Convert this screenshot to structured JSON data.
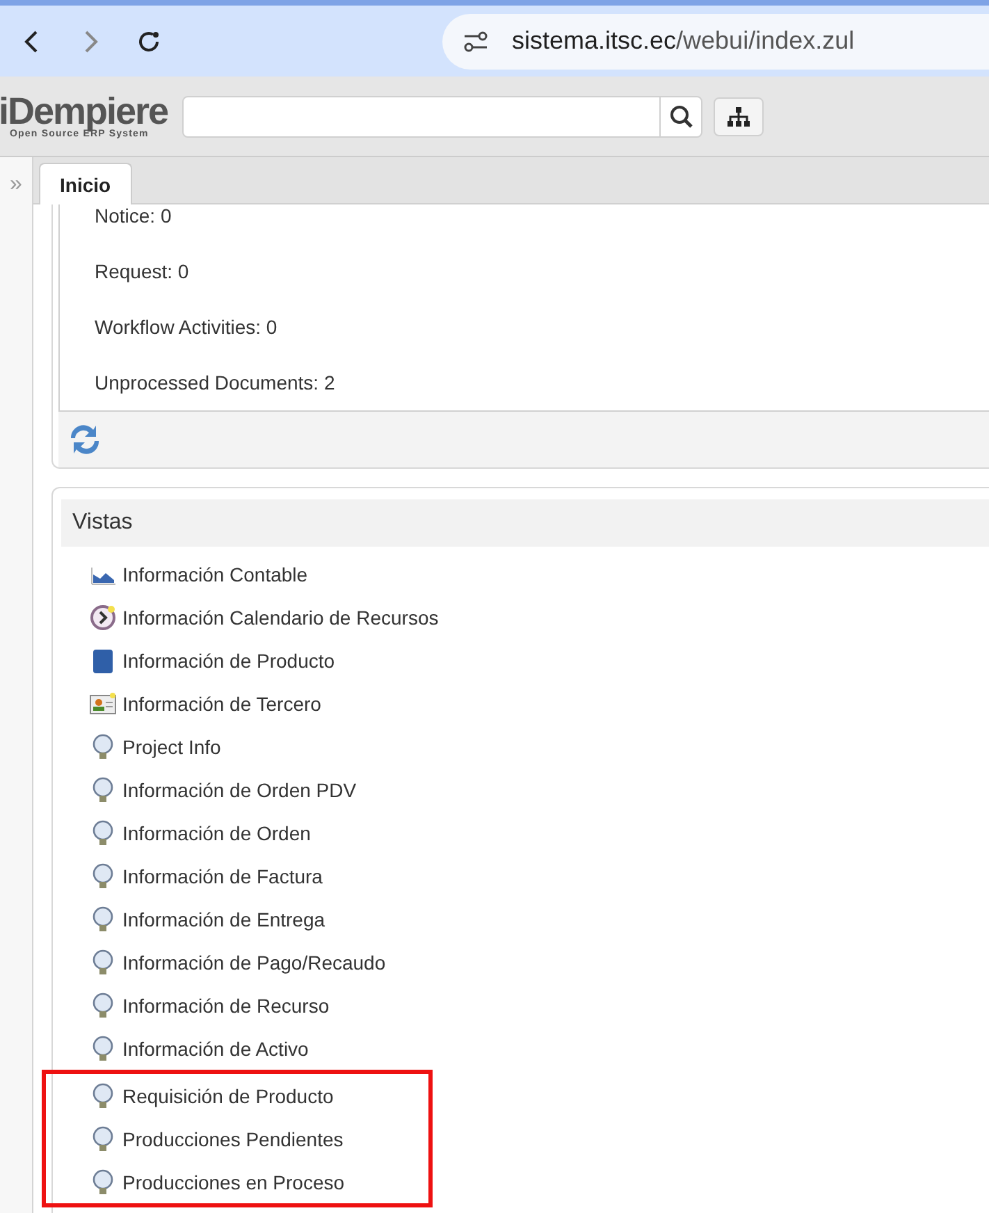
{
  "browser": {
    "url_host": "sistema.itsc.ec",
    "url_path": "/webui/index.zul"
  },
  "header": {
    "logo_title": "iDempiere",
    "logo_subtitle": "Open Source ERP System"
  },
  "sidebar": {
    "toggle": "»"
  },
  "tabs": [
    {
      "label": "Inicio",
      "selected": true
    }
  ],
  "activities": [
    "Notice: 0",
    "Request: 0",
    "Workflow Activities: 0",
    "Unprocessed Documents: 2"
  ],
  "views": {
    "title": "Vistas",
    "items": [
      {
        "label": "Información Contable",
        "kind": "chart",
        "highlighted": false
      },
      {
        "label": "Información Calendario de Recursos",
        "kind": "clock",
        "highlighted": false
      },
      {
        "label": "Información de Producto",
        "kind": "product",
        "highlighted": false
      },
      {
        "label": "Información de Tercero",
        "kind": "card",
        "highlighted": false
      },
      {
        "label": "Project Info",
        "kind": "bulb",
        "highlighted": false
      },
      {
        "label": "Información de Orden PDV",
        "kind": "bulb",
        "highlighted": false
      },
      {
        "label": "Información de Orden",
        "kind": "bulb",
        "highlighted": false
      },
      {
        "label": "Información de Factura",
        "kind": "bulb",
        "highlighted": false
      },
      {
        "label": "Información de Entrega",
        "kind": "bulb",
        "highlighted": false
      },
      {
        "label": "Información de Pago/Recaudo",
        "kind": "bulb",
        "highlighted": false
      },
      {
        "label": "Información de Recurso",
        "kind": "bulb",
        "highlighted": false
      },
      {
        "label": "Información de Activo",
        "kind": "bulb",
        "highlighted": false
      },
      {
        "label": "Requisición de Producto",
        "kind": "bulb",
        "highlighted": true
      },
      {
        "label": "Producciones Pendientes",
        "kind": "bulb",
        "highlighted": true
      },
      {
        "label": "Producciones en Proceso",
        "kind": "bulb",
        "highlighted": true
      }
    ]
  }
}
